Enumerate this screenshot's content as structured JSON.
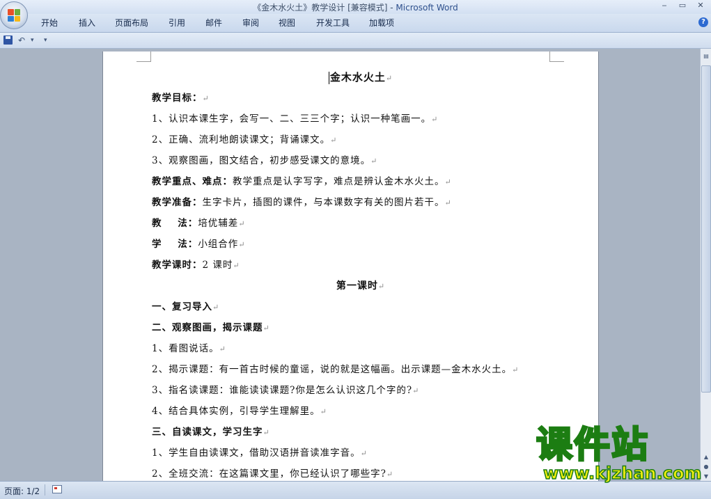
{
  "window": {
    "title_doc": "《金木水火土》教学设计 [兼容模式] - ",
    "title_app": "Microsoft Word",
    "controls": [
      "‒",
      "▭",
      "✕"
    ]
  },
  "ribbon": {
    "tabs": [
      "开始",
      "插入",
      "页面布局",
      "引用",
      "邮件",
      "审阅",
      "视图",
      "开发工具",
      "加载项"
    ],
    "help": "?"
  },
  "qat": {
    "undo": "↶",
    "undo_arrow": "▾",
    "customize": "▾"
  },
  "document": {
    "title": "金木水火土",
    "lines": [
      {
        "bold": "教学目标：",
        "text": ""
      },
      {
        "bold": "",
        "text": "1、认识本课生字，会写一、二、三三个字；认识一种笔画一。"
      },
      {
        "bold": "",
        "text": "2、正确、流利地朗读课文；背诵课文。"
      },
      {
        "bold": "",
        "text": "3、观察图画，图文结合，初步感受课文的意境。"
      },
      {
        "bold": "教学重点、难点：",
        "text": "教学重点是认字写字，难点是辨认金木水火土。"
      },
      {
        "bold": "教学准备：",
        "text": "生字卡片，插图的课件，与本课数字有关的图片若干。"
      },
      {
        "bold": "教    法：",
        "text": "培优辅差"
      },
      {
        "bold": "学    法：",
        "text": "小组合作"
      },
      {
        "bold": "教学课时：",
        "text": "2 课时"
      }
    ],
    "section": "第一课时",
    "lines2": [
      {
        "bold": "一、复习导入",
        "text": ""
      },
      {
        "bold": "二、观察图画，揭示课题",
        "text": ""
      },
      {
        "bold": "",
        "text": "1、看图说话。"
      },
      {
        "bold": "",
        "text": "2、揭示课题：有一首古时候的童谣，说的就是这幅画。出示课题—金木水火土。"
      },
      {
        "bold": "",
        "text": "3、指名读课题：谁能读读课题?你是怎么认识这几个字的?"
      },
      {
        "bold": "",
        "text": "4、结合具体实例，引导学生理解里。"
      },
      {
        "bold": "三、自读课文，学习生字",
        "text": ""
      },
      {
        "bold": "",
        "text": "1、学生自由读课文，借助汉语拼音读准字音。"
      },
      {
        "bold": "",
        "text": "2、全班交流：在这篇课文里，你已经认识了哪些字?"
      }
    ],
    "para_mark": "↵"
  },
  "status": {
    "page": "页面: 1/2"
  },
  "watermark": {
    "brand": "课件站",
    "url": "www.kjzhan.com"
  }
}
